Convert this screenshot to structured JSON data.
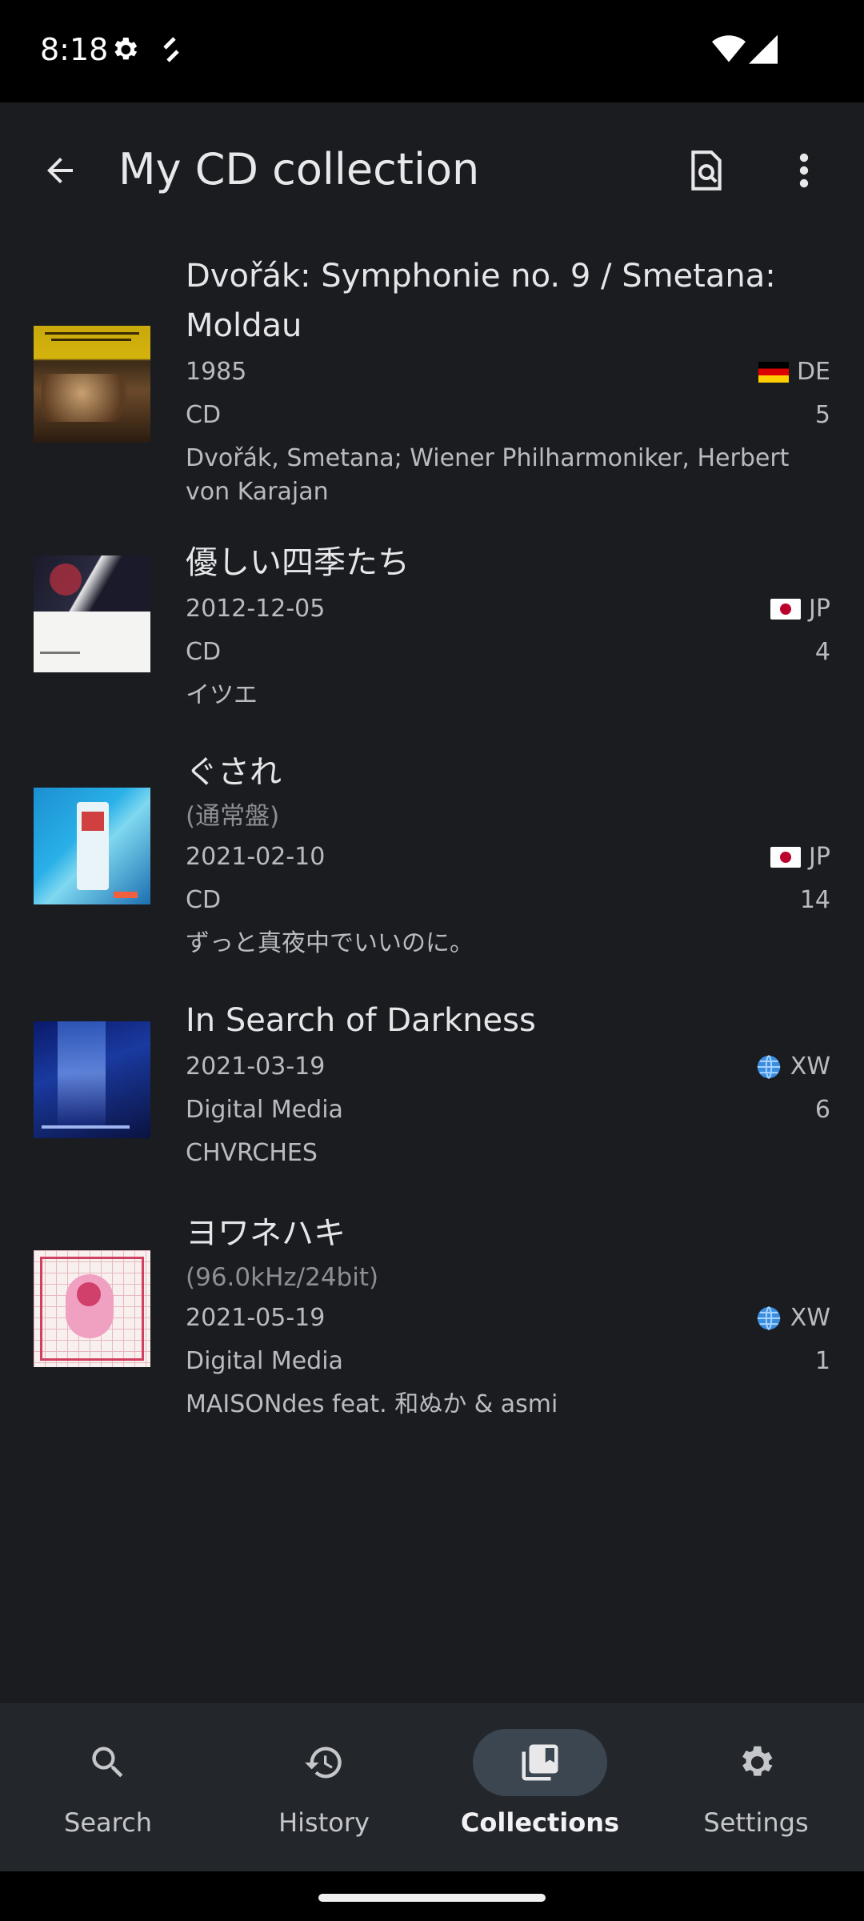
{
  "status_bar": {
    "time": "8:18"
  },
  "app_bar": {
    "title": "My CD collection"
  },
  "items": [
    {
      "title": "Dvořák: Symphonie no. 9 / Smetana: Moldau",
      "subtitle": "",
      "date": "1985",
      "country": "DE",
      "country_flag": "flag-de",
      "format": "CD",
      "tracks": "5",
      "artist": "Dvořák, Smetana; Wiener Philharmoniker, Herbert von Karajan"
    },
    {
      "title": "優しい四季たち",
      "subtitle": "",
      "date": "2012-12-05",
      "country": "JP",
      "country_flag": "flag-jp",
      "format": "CD",
      "tracks": "4",
      "artist": "イツエ"
    },
    {
      "title": "ぐされ",
      "subtitle": "(通常盤)",
      "date": "2021-02-10",
      "country": "JP",
      "country_flag": "flag-jp",
      "format": "CD",
      "tracks": "14",
      "artist": "ずっと真夜中でいいのに。"
    },
    {
      "title": "In Search of Darkness",
      "subtitle": "",
      "date": "2021-03-19",
      "country": "XW",
      "country_flag": "globe-icon",
      "format": "Digital Media",
      "tracks": "6",
      "artist": "CHVRCHES"
    },
    {
      "title": "ヨワネハキ",
      "subtitle": "(96.0kHz/24bit)",
      "date": "2021-05-19",
      "country": "XW",
      "country_flag": "globe-icon",
      "format": "Digital Media",
      "tracks": "1",
      "artist": "MAISONdes feat. 和ぬか & asmi"
    }
  ],
  "bottom_nav": {
    "items": [
      {
        "label": "Search",
        "icon": "search-icon",
        "active": false
      },
      {
        "label": "History",
        "icon": "history-icon",
        "active": false
      },
      {
        "label": "Collections",
        "icon": "collections-icon",
        "active": true
      },
      {
        "label": "Settings",
        "icon": "gear-icon",
        "active": false
      }
    ]
  },
  "colors": {
    "background": "#1a1c20",
    "nav_background": "#23262b",
    "nav_active_pill": "#3c4651"
  }
}
